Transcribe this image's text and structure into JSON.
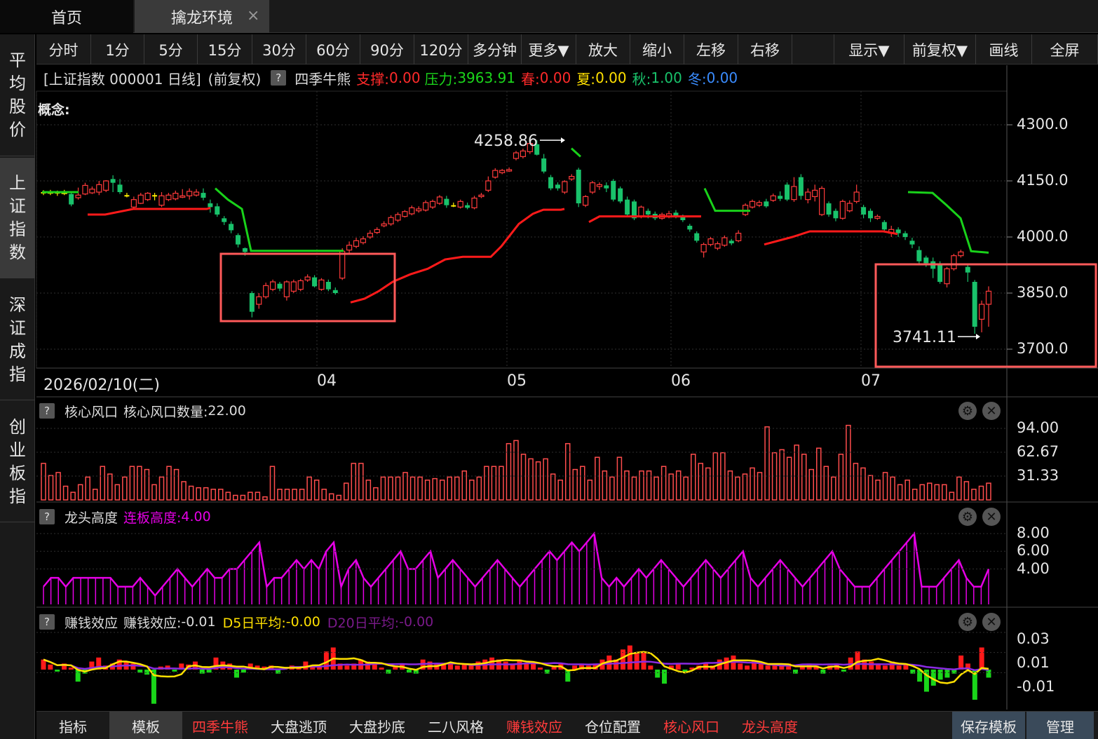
{
  "tabs": {
    "home": "首页",
    "qinlong": "擒龙环境",
    "close": "×"
  },
  "sidebar": {
    "items": [
      {
        "label": "平均股价",
        "active": false
      },
      {
        "label": "上证指数",
        "active": true
      },
      {
        "label": "深证成指",
        "active": false
      },
      {
        "label": "创业板指",
        "active": false
      }
    ]
  },
  "toolbar": {
    "items": [
      "分时",
      "1分",
      "5分",
      "15分",
      "30分",
      "60分",
      "90分",
      "120分",
      "多分钟",
      "更多▼",
      "放大",
      "缩小",
      "左移",
      "右移",
      "",
      "显示▼",
      "前复权▼",
      "画线",
      "全屏"
    ]
  },
  "info": {
    "security": "[上证指数 000001 日线]",
    "adjust": "(前复权)",
    "help": "?",
    "indicator": "四季牛熊",
    "support_label": "支撑:",
    "support_value": "0.00",
    "pressure_label": "压力:",
    "pressure_value": "3963.91",
    "spring_label": "春:",
    "spring_value": "0.00",
    "summer_label": "夏:",
    "summer_value": "0.00",
    "autumn_label": "秋:",
    "autumn_value": "1.00",
    "winter_label": "冬:",
    "winter_value": "0.00",
    "concept": "概念:"
  },
  "main_chart": {
    "y_ticks": [
      "4300.0",
      "4150.0",
      "4000.0",
      "3850.0",
      "3700.0"
    ],
    "y_tick_values": [
      4300,
      4150,
      4000,
      3850,
      3700
    ],
    "x_labels": [
      "2026/02/10(二)",
      "04",
      "05",
      "06",
      "07"
    ],
    "high_annotation": "4258.86",
    "low_annotation": "3741.11",
    "colors": {
      "up": "#ff3b3b",
      "down": "#19c26b",
      "flat": "#ffee00",
      "support": "#ff1a1a",
      "pressure": "#19d21a",
      "highlight": "#ff5a5a"
    }
  },
  "panel1": {
    "help": "?",
    "name": "核心风口",
    "value_label": "核心风口数量:",
    "value": "22.00",
    "y_ticks": [
      "94.00",
      "62.67",
      "31.33"
    ]
  },
  "panel2": {
    "help": "?",
    "name": "龙头高度",
    "value_label": "连板高度:",
    "value": "4.00",
    "y_ticks": [
      "8.00",
      "6.00",
      "4.00"
    ]
  },
  "panel3": {
    "help": "?",
    "name": "赚钱效应",
    "value_label": "赚钱效应:",
    "value": "-0.01",
    "d5_label": "D5日平均:",
    "d5_value": "-0.00",
    "d20_label": "D20日平均:",
    "d20_value": "-0.00",
    "y_ticks": [
      "0.03",
      "0.01",
      "-0.01"
    ]
  },
  "bottombar": {
    "items": [
      {
        "label": "指标",
        "color": "#e6e6e6"
      },
      {
        "label": "模板",
        "color": "#e6e6e6"
      },
      {
        "label": "四季牛熊",
        "color": "#ff3b3b"
      },
      {
        "label": "大盘逃顶",
        "color": "#e6e6e6"
      },
      {
        "label": "大盘抄底",
        "color": "#e6e6e6"
      },
      {
        "label": "二八风格",
        "color": "#e6e6e6"
      },
      {
        "label": "赚钱效应",
        "color": "#ff3b3b"
      },
      {
        "label": "仓位配置",
        "color": "#e6e6e6"
      },
      {
        "label": "核心风口",
        "color": "#ff3b3b"
      },
      {
        "label": "龙头高度",
        "color": "#ff3b3b"
      }
    ],
    "save_template": "保存模板",
    "manage": "管理"
  }
}
